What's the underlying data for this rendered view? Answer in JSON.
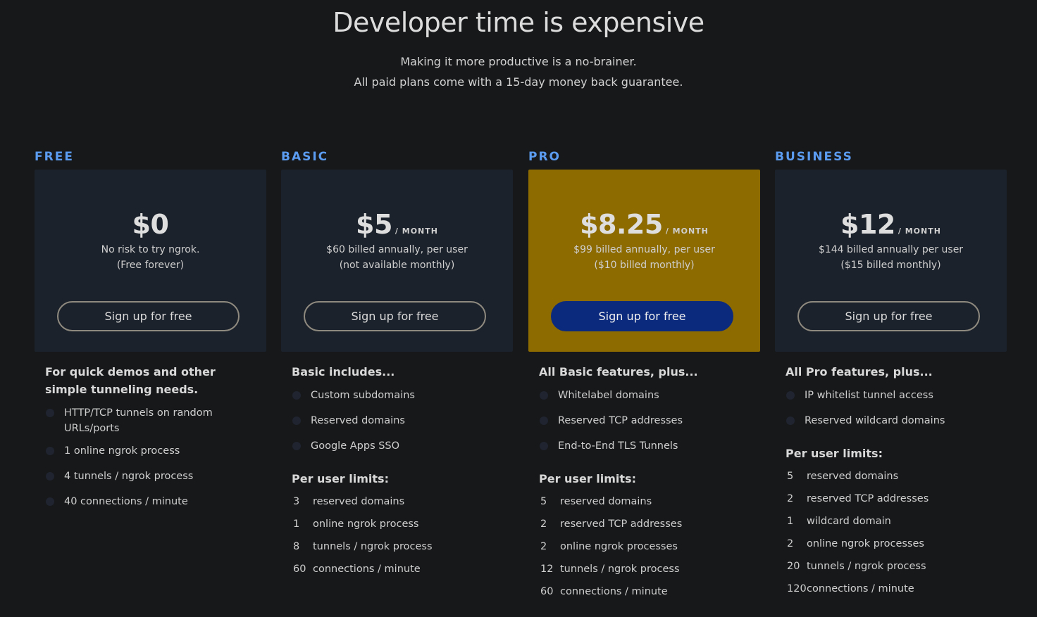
{
  "hero": {
    "title": "Developer time is expensive",
    "subtitle_1": "Making it more productive is a no-brainer.",
    "subtitle_2": "All paid plans come with a 15-day money back guarantee."
  },
  "plans": [
    {
      "name": "FREE",
      "price": "$0",
      "per": "",
      "billing_1": "No risk to try ngrok.",
      "billing_2": "(Free forever)",
      "cta": "Sign up for free",
      "features_heading": "For quick demos and other simple tunneling needs.",
      "features": [
        "HTTP/TCP tunnels on random URLs/ports",
        "1 online ngrok process",
        "4 tunnels / ngrok process",
        "40 connections / minute"
      ]
    },
    {
      "name": "BASIC",
      "price": "$5",
      "per": "/ MONTH",
      "billing_1": "$60 billed annually, per user",
      "billing_2": "(not available monthly)",
      "cta": "Sign up for free",
      "features_heading": "Basic includes...",
      "features": [
        "Custom subdomains",
        "Reserved domains",
        "Google Apps SSO"
      ],
      "limits_heading": "Per user limits:",
      "limits": [
        {
          "num": "3",
          "text": "reserved domains"
        },
        {
          "num": "1",
          "text": "online ngrok process"
        },
        {
          "num": "8",
          "text": "tunnels / ngrok process"
        },
        {
          "num": "60",
          "text": "connections / minute"
        }
      ]
    },
    {
      "name": "PRO",
      "price": "$8.25",
      "per": "/ MONTH",
      "billing_1": "$99 billed annually, per user",
      "billing_2": "($10 billed monthly)",
      "cta": "Sign up for free",
      "features_heading": "All Basic features, plus...",
      "features": [
        "Whitelabel domains",
        "Reserved TCP addresses",
        "End-to-End TLS Tunnels"
      ],
      "limits_heading": "Per user limits:",
      "limits": [
        {
          "num": "5",
          "text": "reserved domains"
        },
        {
          "num": "2",
          "text": "reserved TCP addresses"
        },
        {
          "num": "2",
          "text": "online ngrok processes"
        },
        {
          "num": "12",
          "text": "tunnels / ngrok process"
        },
        {
          "num": "60",
          "text": "connections / minute"
        }
      ]
    },
    {
      "name": "BUSINESS",
      "price": "$12",
      "per": "/ MONTH",
      "billing_1": "$144 billed annually per user",
      "billing_2": "($15 billed monthly)",
      "cta": "Sign up for free",
      "features_heading": "All Pro features, plus...",
      "features": [
        "IP whitelist tunnel access",
        "Reserved wildcard domains"
      ],
      "limits_heading": "Per user limits:",
      "limits": [
        {
          "num": "5",
          "text": "reserved domains"
        },
        {
          "num": "2",
          "text": "reserved TCP addresses"
        },
        {
          "num": "1",
          "text": "wildcard domain"
        },
        {
          "num": "2",
          "text": "online ngrok processes"
        },
        {
          "num": "20",
          "text": "tunnels / ngrok process"
        },
        {
          "num": "120",
          "text": "connections / minute"
        }
      ]
    }
  ],
  "colors": {
    "background": "#17181a",
    "card": "#1c222b",
    "featured_card": "#8d6b00",
    "plan_name": "#5b9bf0",
    "primary_button": "#0c2a7d"
  }
}
